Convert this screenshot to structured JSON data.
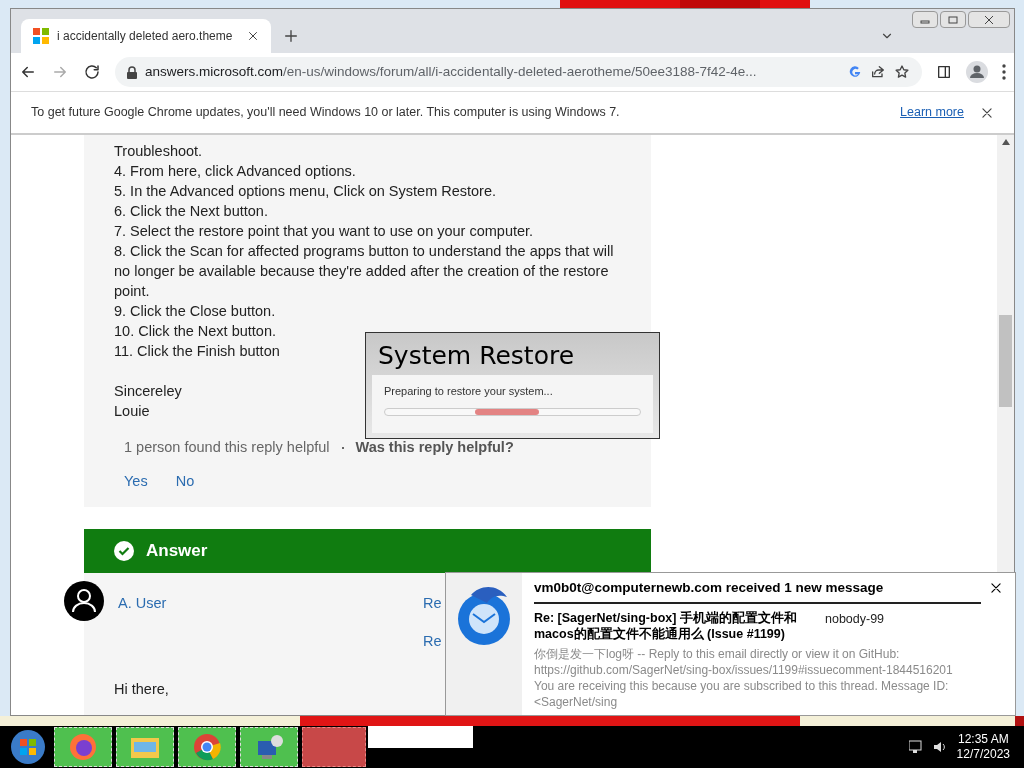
{
  "browser": {
    "tab": {
      "title": "i accidentally deleted aero.theme",
      "selected": true
    },
    "address": {
      "host": "answers.microsoft.com",
      "path": "/en-us/windows/forum/all/i-accidentally-deleted-aerotheme/50ee3188-7f42-4e..."
    },
    "infobar": {
      "message": "To get future Google Chrome updates, you'll need Windows 10 or later. This computer is using Windows 7.",
      "link": "Learn more"
    }
  },
  "post": {
    "lines": [
      "Troubleshoot.",
      "4. From here, click Advanced options.",
      "5. In the Advanced options menu, Click on System Restore.",
      "6. Click the Next button.",
      "7. Select the restore point that you want to use on your computer.",
      "8. Click the Scan for affected programs button to understand the apps that will no longer be available because they're added after the creation of the restore point.",
      "9. Click the Close button.",
      "10. Click the Next button.",
      "11. Click the Finish button"
    ],
    "signature": [
      "Sincereley",
      "Louie"
    ],
    "helpful_count": "1 person found this reply helpful",
    "helpful_question": "Was this reply helpful?",
    "votes": [
      "Yes",
      "No"
    ]
  },
  "restore_dialog": {
    "title": "System Restore",
    "message": "Preparing to restore your system..."
  },
  "answer": {
    "banner": "Answer",
    "user": "A. User",
    "links": [
      "Re",
      "Re"
    ],
    "greeting": "Hi there,"
  },
  "notification": {
    "header": "vm0b0t@computernewb.com received 1 new message",
    "subject": "Re: [SagerNet/sing-box] 手机端的配置文件和macos的配置文件不能通用么 (Issue #1199)",
    "sender": "nobody-99",
    "body": [
      "你倒是发一下log呀 -- Reply to this email directly or view it on GitHub:",
      "https://github.com/SagerNet/sing-box/issues/1199#issuecomment-1844516201",
      "You are receiving this because you are subscribed to this thread. Message ID:",
      "<SagerNet/sing"
    ]
  },
  "taskbar": {
    "time": "12:35 AM",
    "date": "12/7/2023"
  }
}
